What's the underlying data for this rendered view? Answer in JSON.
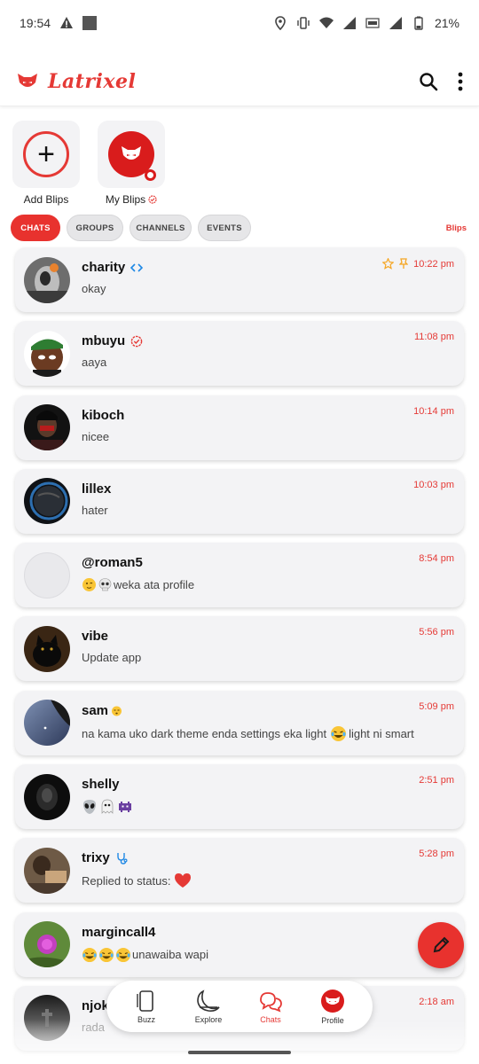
{
  "status_bar": {
    "time": "19:54",
    "battery": "21%"
  },
  "app": {
    "title": "Latrixel",
    "accent_color": "#e53935"
  },
  "blips": {
    "add_label": "Add Blips",
    "my_label": "My Blips"
  },
  "tabs": [
    {
      "label": "CHATS",
      "active": true
    },
    {
      "label": "GROUPS",
      "active": false
    },
    {
      "label": "CHANNELS",
      "active": false
    },
    {
      "label": "EVENTS",
      "active": false
    }
  ],
  "tabs_right_label": "Blips",
  "chats": [
    {
      "name": "charity",
      "message": "okay",
      "time": "10:22 pm"
    },
    {
      "name": "mbuyu",
      "message": "aaya",
      "time": "11:08 pm"
    },
    {
      "name": "kiboch",
      "message": "nicee",
      "time": "10:14 pm"
    },
    {
      "name": "lillex",
      "message": "hater",
      "time": "10:03 pm"
    },
    {
      "name": "@roman5",
      "message": "weka ata profile",
      "time": "8:54 pm"
    },
    {
      "name": "vibe",
      "message": "Update app",
      "time": "5:56 pm"
    },
    {
      "name": "sam",
      "message_before": "na kama uko dark theme enda settings eka light",
      "message_after": "light ni smart",
      "time": "5:09 pm"
    },
    {
      "name": "shelly",
      "message": "",
      "time": "2:51 pm"
    },
    {
      "name": "trixy",
      "message": "Replied to status:",
      "time": "5:28 pm"
    },
    {
      "name": "margincall4",
      "message": "unawaiba wapi",
      "time": "2:"
    },
    {
      "name": "njok",
      "message": "rada",
      "time": "2:18 am"
    }
  ],
  "nav": [
    {
      "label": "Buzz",
      "icon": "phone-icon"
    },
    {
      "label": "Explore",
      "icon": "moon-icon"
    },
    {
      "label": "Chats",
      "icon": "chat-icon"
    },
    {
      "label": "Profile",
      "icon": "avatar-icon"
    }
  ]
}
